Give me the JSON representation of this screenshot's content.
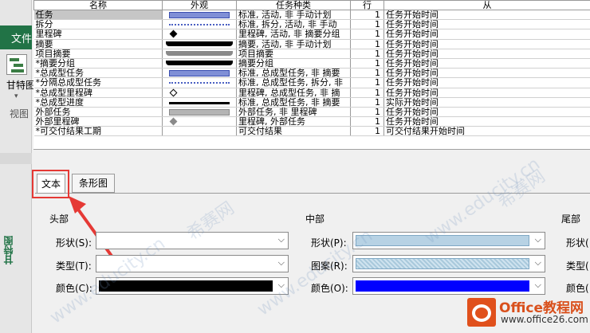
{
  "ribbon": {
    "file_tab": "文件",
    "gantt_label": "甘特图",
    "view_group": "视图",
    "vertical_label": "甘特图"
  },
  "styles_table": {
    "headers": [
      "名称",
      "外观",
      "任务种类",
      "行",
      "从"
    ],
    "rows": [
      {
        "name": "任务",
        "kind": "标准, 活动, 非 手动计划",
        "row": "1",
        "from": "任务开始时间",
        "appearance": "blue-bar"
      },
      {
        "name": "拆分",
        "kind": "标准, 拆分, 活动, 非 手动",
        "row": "1",
        "from": "任务开始时间",
        "appearance": "dotted-line"
      },
      {
        "name": "里程碑",
        "kind": "里程碑, 活动, 非 摘要分组",
        "row": "1",
        "from": "任务开始时间",
        "appearance": "diamond"
      },
      {
        "name": "摘要",
        "kind": "摘要, 活动, 非 手动计划",
        "row": "1",
        "from": "任务开始时间",
        "appearance": "summary-bar"
      },
      {
        "name": "项目摘要",
        "kind": "项目摘要",
        "row": "1",
        "from": "任务开始时间",
        "appearance": "gray-summary-bar"
      },
      {
        "name": "*摘要分组",
        "kind": "摘要分组",
        "row": "1",
        "from": "任务开始时间",
        "appearance": "summary-bar"
      },
      {
        "name": "*总成型任务",
        "kind": "标准, 总成型任务, 非 摘要",
        "row": "1",
        "from": "任务开始时间",
        "appearance": "blue-bar"
      },
      {
        "name": "*分隔总成型任务",
        "kind": "标准, 总成型任务, 拆分, 非",
        "row": "1",
        "from": "任务开始时间",
        "appearance": "dotted-line"
      },
      {
        "name": "*总成型里程碑",
        "kind": "里程碑, 总成型任务, 非 摘",
        "row": "1",
        "from": "任务开始时间",
        "appearance": "hollow-diamond"
      },
      {
        "name": "*总成型进度",
        "kind": "标准, 总成型任务, 非 摘要",
        "row": "1",
        "from": "实际开始时间",
        "appearance": "thin-line"
      },
      {
        "name": "外部任务",
        "kind": "外部任务, 非 里程碑",
        "row": "1",
        "from": "任务开始时间",
        "appearance": "gray-bar"
      },
      {
        "name": "外部里程碑",
        "kind": "里程碑, 外部任务",
        "row": "1",
        "from": "任务开始时间",
        "appearance": "gray-diamond"
      },
      {
        "name": "*可交付结果工期",
        "kind": "可交付结果",
        "row": "1",
        "from": "可交付结果开始时间",
        "appearance": "none"
      }
    ]
  },
  "tabs": {
    "text": "文本",
    "bar_style": "条形图"
  },
  "panel": {
    "head": {
      "title": "头部",
      "shape_label": "形状(S):",
      "type_label": "类型(T):",
      "color_label": "颜色(C):",
      "color_value": "#000000"
    },
    "middle": {
      "title": "中部",
      "shape_label": "形状(P):",
      "pattern_label": "图案(R):",
      "color_label": "颜色(O):",
      "color_value": "#0000ff"
    },
    "tail": {
      "title": "尾部",
      "shape_label": "形状(",
      "type_label": "类型(",
      "color_label": "颜色("
    }
  },
  "watermark": {
    "cn": "希赛网",
    "url": "www.educity.cn"
  },
  "logo": {
    "title": "Office教程网",
    "url": "www.office26.com"
  },
  "colors": {
    "annotation_red": "#e53935",
    "ribbon_green": "#217346",
    "bar_blue": "#7f8fd6",
    "logo_orange": "#e0501c"
  }
}
